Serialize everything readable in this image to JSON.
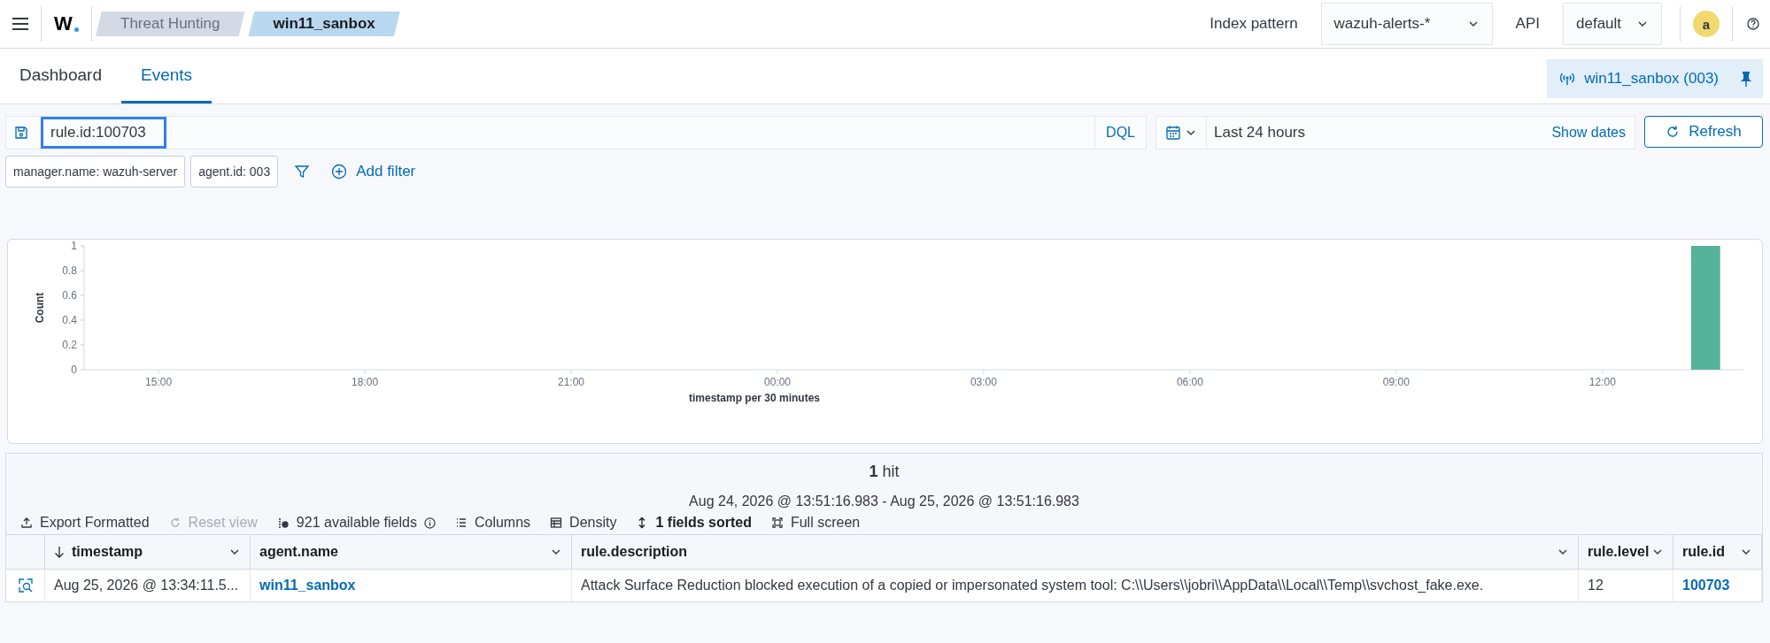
{
  "header": {
    "logo": "W",
    "breadcrumbs": [
      {
        "label": "Threat Hunting",
        "selected": false
      },
      {
        "label": "win11_sanbox",
        "selected": true
      }
    ],
    "index_pattern": {
      "label": "Index pattern",
      "value": "wazuh-alerts-*"
    },
    "api": {
      "label": "API",
      "value": "default"
    },
    "avatar": "a"
  },
  "tabs": [
    {
      "label": "Dashboard",
      "selected": false
    },
    {
      "label": "Events",
      "selected": true
    }
  ],
  "agent_badge": "win11_sanbox (003)",
  "query_bar": {
    "query": "rule.id:100703",
    "focused": true,
    "language": "DQL",
    "time_range": "Last 24 hours",
    "show_dates": "Show dates",
    "refresh": "Refresh"
  },
  "filters": [
    "manager.name: wazuh-server",
    "agent.id: 003"
  ],
  "add_filter": "Add filter",
  "chart": {
    "chart_data": {
      "type": "bar",
      "xlabel": "timestamp per 30 minutes",
      "ylabel": "Count",
      "x": [
        "2026-08-25T13:30"
      ],
      "series": [
        {
          "color": "#54b399",
          "values": [
            1
          ]
        }
      ],
      "xlim": [
        "2026-08-24T13:55",
        "2026-08-25T14:03"
      ],
      "ylim": [
        0,
        1
      ],
      "xticks": [
        {
          "value": "2026-08-24T15:00",
          "label": "15:00"
        },
        {
          "value": "2026-08-24T18:00",
          "label": "18:00"
        },
        {
          "value": "2026-08-24T21:00",
          "label": "21:00"
        },
        {
          "value": "2026-08-25T00:00",
          "label": "00:00"
        },
        {
          "value": "2026-08-25T03:00",
          "label": "03:00"
        },
        {
          "value": "2026-08-25T06:00",
          "label": "06:00"
        },
        {
          "value": "2026-08-25T09:00",
          "label": "09:00"
        },
        {
          "value": "2026-08-25T12:00",
          "label": "12:00"
        }
      ],
      "yticks": [
        0,
        0.2,
        0.4,
        0.6,
        0.8,
        1
      ]
    }
  },
  "results": {
    "hits": "**1** hit",
    "range": "Aug 24, 2026 @ 13:51:16.983 - Aug 25, 2026 @ 13:51:16.983",
    "toolbar": [
      {
        "kind": "export",
        "label": "Export Formatted",
        "disabled": false
      },
      {
        "kind": "reset",
        "label": "Reset view",
        "disabled": true
      },
      {
        "kind": "fields",
        "label": "921 available fields",
        "disabled": false
      },
      {
        "kind": "columns",
        "label": "Columns",
        "disabled": false
      },
      {
        "kind": "density",
        "label": "Density",
        "disabled": false
      },
      {
        "kind": "sort",
        "label": "1 fields sorted",
        "disabled": false
      },
      {
        "kind": "fullscreen",
        "label": "Full screen",
        "disabled": false
      }
    ],
    "table": {
      "columns": [
        {
          "label": "timestamp",
          "sorted": true
        },
        {
          "label": "agent.name",
          "sorted": false
        },
        {
          "label": "rule.description",
          "sorted": false
        },
        {
          "label": "rule.level",
          "sorted": false
        },
        {
          "label": "rule.id",
          "sorted": false
        }
      ],
      "rows": [
        {
          "cells": [
            {
              "kind": "text",
              "text": "Aug 25, 2026 @ 13:34:11.5..."
            },
            {
              "kind": "link",
              "text": "win11_sanbox"
            },
            {
              "kind": "text",
              "text": "Attack Surface Reduction blocked execution of a copied or impersonated system tool: C:\\\\Users\\\\jobri\\\\AppData\\\\Local\\\\Temp\\\\svchost_fake.exe."
            },
            {
              "kind": "text",
              "text": "12"
            },
            {
              "kind": "link",
              "text": "100703"
            }
          ]
        }
      ]
    }
  }
}
